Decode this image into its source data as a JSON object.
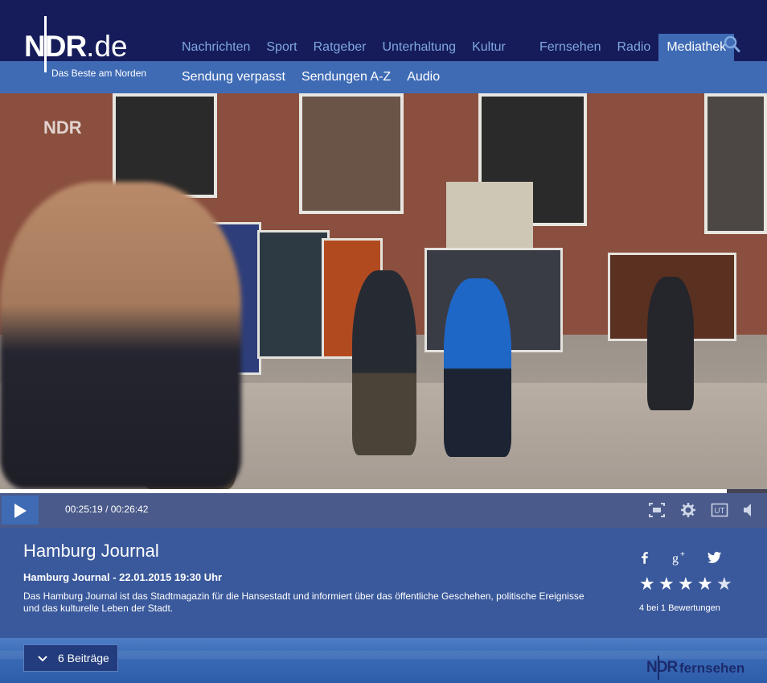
{
  "header": {
    "logo_text": "NDR",
    "logo_suffix": ".de",
    "tagline": "Das Beste am Norden",
    "nav": [
      "Nachrichten",
      "Sport",
      "Ratgeber",
      "Unterhaltung",
      "Kultur"
    ],
    "nav_right": [
      "Fernsehen",
      "Radio",
      "Mediathek"
    ],
    "active": "Mediathek",
    "search_icon": "search-icon"
  },
  "subnav": [
    "Sendung verpasst",
    "Sendungen A-Z",
    "Audio"
  ],
  "player": {
    "watermark": "NDR",
    "current_time": "00:25:19",
    "separator": "/",
    "duration": "00:26:42",
    "progress_fraction": 0.948,
    "controls": [
      "fullscreen-icon",
      "settings-gear-icon",
      "subtitles-ut-icon",
      "volume-icon"
    ],
    "subtitles_label": "UT"
  },
  "info": {
    "title": "Hamburg Journal",
    "subtitle": "Hamburg Journal - 22.01.2015 19:30 Uhr",
    "description": "Das Hamburg Journal ist das Stadtmagazin für die Hansestadt und informiert über das öffentliche Geschehen, politische Ereignisse und das kulturelle Leben der Stadt.",
    "social": [
      "facebook-icon",
      "google-plus-icon",
      "twitter-icon"
    ],
    "rating_stars": 5,
    "rating_text": "4 bei 1 Bewertungen"
  },
  "footer": {
    "beitraege_label": "6 Beiträge",
    "channel_logo_ndr": "NDR",
    "channel_logo_word": "fernsehen"
  },
  "colors": {
    "header_dark": "#161c5a",
    "header_light": "#3f6bb5",
    "nav_text": "#7fa7e0",
    "info_bg": "#3a599c"
  }
}
